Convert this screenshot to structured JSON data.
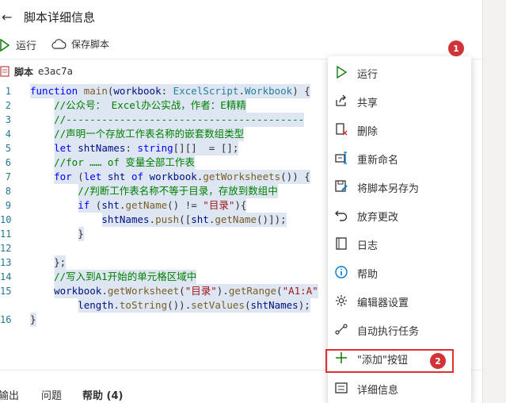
{
  "header": {
    "title": "脚本详细信息",
    "back_glyph": "←"
  },
  "toolbar": {
    "run_label": "运行",
    "save_label": "保存脚本"
  },
  "script": {
    "label": "脚本",
    "id": "e3ac7a"
  },
  "code_lines": [
    {
      "n": "1",
      "text": "function main(workbook: ExcelScript.Workbook) {"
    },
    {
      "n": "2",
      "text": "    //公众号： Excel办公实战，作者：E精精"
    },
    {
      "n": "3",
      "text": "    //----------------------------------------"
    },
    {
      "n": "4",
      "text": "    //声明一个存放工作表名称的嵌套数组类型"
    },
    {
      "n": "5",
      "text": "    let shtNames: string[][]  = [];"
    },
    {
      "n": "6",
      "text": "    //for …… of 变量全部工作表"
    },
    {
      "n": "7",
      "text": "    for (let sht of workbook.getWorksheets()) {"
    },
    {
      "n": "8",
      "text": "        //判断工作表名称不等于目录，存放到数组中"
    },
    {
      "n": "9",
      "text": "        if (sht.getName() != \"目录\"){"
    },
    {
      "n": "10",
      "text": "            shtNames.push([sht.getName()]);"
    },
    {
      "n": "11",
      "text": "        }"
    },
    {
      "n": "12",
      "text": ""
    },
    {
      "n": "13",
      "text": "    };"
    },
    {
      "n": "14",
      "text": "    //写入到A1开始的单元格区域中"
    },
    {
      "n": "15",
      "text": "    workbook.getWorksheet(\"目录\").getRange(\"A1:A\""
    },
    {
      "n": "",
      "text": "        length.toString()).setValues(shtNames);"
    },
    {
      "n": "16",
      "text": "}"
    }
  ],
  "bottom_tabs": {
    "output": "输出",
    "problems": "问题",
    "help": "帮助 (4)"
  },
  "badges": {
    "one": "1",
    "two": "2"
  },
  "menu": {
    "items": [
      {
        "label": "运行",
        "icon": "play-icon"
      },
      {
        "label": "共享",
        "icon": "share-icon"
      },
      {
        "label": "删除",
        "icon": "delete-icon"
      },
      {
        "label": "重新命名",
        "icon": "rename-icon"
      },
      {
        "label": "将脚本另存为",
        "icon": "save-as-icon"
      },
      {
        "label": "放弃更改",
        "icon": "undo-icon"
      },
      {
        "label": "日志",
        "icon": "log-icon"
      },
      {
        "label": "帮助",
        "icon": "info-icon"
      },
      {
        "label": "编辑器设置",
        "icon": "gear-icon"
      },
      {
        "label": "自动执行任务",
        "icon": "flow-icon"
      },
      {
        "label": "\"添加\"按钮",
        "icon": "plus-icon"
      },
      {
        "label": "详细信息",
        "icon": "details-icon"
      }
    ]
  },
  "colors": {
    "accent_green": "#107c10",
    "badge_red": "#d13438",
    "highlight_red": "#e03030",
    "selection": "#dde6f2"
  }
}
